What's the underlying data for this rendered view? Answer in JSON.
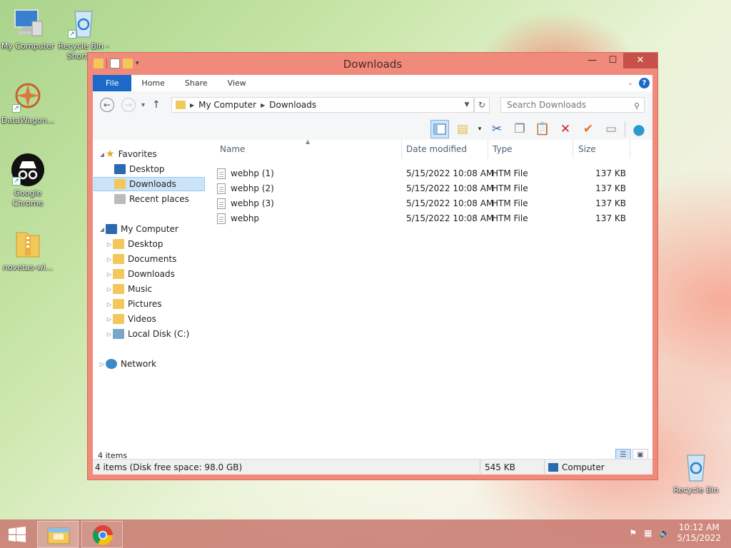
{
  "desktop": {
    "icons": [
      {
        "label": "My Computer"
      },
      {
        "label": "Recycle Bin - Shortcut"
      },
      {
        "label": "DataWagon..."
      },
      {
        "label": "Google Chrome"
      },
      {
        "label": "novetus-wi..."
      },
      {
        "label": "Recycle Bin"
      }
    ]
  },
  "window": {
    "title": "Downloads",
    "controls": {
      "minimize": "—",
      "maximize": "☐",
      "close": "✕"
    },
    "ribbon": {
      "tabs": [
        "File",
        "Home",
        "Share",
        "View"
      ],
      "help": "?"
    },
    "address": {
      "crumbs": [
        "My Computer",
        "Downloads"
      ],
      "search_placeholder": "Search Downloads"
    },
    "nav": {
      "favorites": "Favorites",
      "fav_items": [
        "Desktop",
        "Downloads",
        "Recent places"
      ],
      "computer": "My Computer",
      "computer_items": [
        "Desktop",
        "Documents",
        "Downloads",
        "Music",
        "Pictures",
        "Videos",
        "Local Disk (C:)"
      ],
      "network": "Network"
    },
    "columns": {
      "name": "Name",
      "date": "Date modified",
      "type": "Type",
      "size": "Size"
    },
    "files": [
      {
        "name": "webhp (1)",
        "date": "5/15/2022 10:08 AM",
        "type": "HTM File",
        "size": "137 KB"
      },
      {
        "name": "webhp (2)",
        "date": "5/15/2022 10:08 AM",
        "type": "HTM File",
        "size": "137 KB"
      },
      {
        "name": "webhp (3)",
        "date": "5/15/2022 10:08 AM",
        "type": "HTM File",
        "size": "137 KB"
      },
      {
        "name": "webhp",
        "date": "5/15/2022 10:08 AM",
        "type": "HTM File",
        "size": "137 KB"
      }
    ],
    "status": {
      "count": "4 items"
    },
    "details": {
      "summary": "4 items (Disk free space: 98.0 GB)",
      "size": "545 KB",
      "location": "Computer"
    }
  },
  "taskbar": {
    "time": "10:12 AM",
    "date": "5/15/2022"
  },
  "colors": {
    "file_tab": "#1b6ac9",
    "frame": "#f08a7b",
    "close": "#c7504a"
  }
}
